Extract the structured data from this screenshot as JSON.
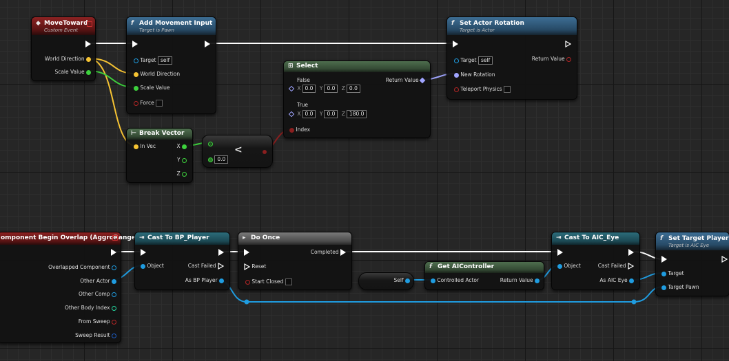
{
  "colors": {
    "exec": "#ffffff",
    "vector": "#f5c333",
    "float": "#3dd13d",
    "object": "#1f9ce0",
    "rotator": "#a0a5ff",
    "bool": "#b42626",
    "int": "#26d9a1",
    "struct": "#1d5cc4"
  },
  "nodes": {
    "move_toward": {
      "title": "MoveToward",
      "subtitle": "Custom Event",
      "pins": {
        "world_direction": "World Direction",
        "scale_value": "Scale Value"
      }
    },
    "add_movement": {
      "title": "Add Movement Input",
      "subtitle": "Target is Pawn",
      "pins": {
        "target": "Target",
        "target_value": "self",
        "world_direction": "World Direction",
        "scale_value": "Scale Value",
        "force": "Force"
      }
    },
    "set_rotation": {
      "title": "Set Actor Rotation",
      "subtitle": "Target is Actor",
      "pins": {
        "target": "Target",
        "target_value": "self",
        "return_value": "Return Value",
        "new_rotation": "New Rotation",
        "teleport": "Teleport Physics"
      }
    },
    "select": {
      "title": "Select",
      "pins": {
        "false": "False",
        "true": "True",
        "return_value": "Return Value",
        "index": "Index"
      },
      "false_vals": {
        "x": "0.0",
        "y": "0.0",
        "z": "0.0"
      },
      "true_vals": {
        "x": "0.0",
        "y": "0.0",
        "z": "180.0"
      },
      "axis": {
        "x": "X",
        "y": "Y",
        "z": "Z"
      }
    },
    "break_vector": {
      "title": "Break Vector",
      "pins": {
        "in_vec": "In Vec",
        "x": "X",
        "y": "Y",
        "z": "Z"
      }
    },
    "compare": {
      "op": "<",
      "value": "0.0"
    },
    "overlap": {
      "title": "omponent Begin Overlap (AggroRange)",
      "pins": {
        "overlapped": "Overlapped Component",
        "other_actor": "Other Actor",
        "other_comp": "Other Comp",
        "body_index": "Other Body Index",
        "from_sweep": "From Sweep",
        "sweep_result": "Sweep Result"
      }
    },
    "cast_player": {
      "title": "Cast To BP_Player",
      "pins": {
        "object": "Object",
        "cast_failed": "Cast Failed",
        "as_player": "As BP Player"
      }
    },
    "do_once": {
      "title": "Do Once",
      "pins": {
        "completed": "Completed",
        "reset": "Reset",
        "start_closed": "Start Closed"
      }
    },
    "self_node": {
      "label": "Self"
    },
    "get_controller": {
      "title": "Get AIController",
      "pins": {
        "controlled_actor": "Controlled Actor",
        "return_value": "Return Value"
      }
    },
    "cast_eye": {
      "title": "Cast To AIC_Eye",
      "pins": {
        "object": "Object",
        "cast_failed": "Cast Failed",
        "as_eye": "As AIC Eye"
      }
    },
    "set_target": {
      "title": "Set Target Player",
      "subtitle": "Target is AIC Eye",
      "pins": {
        "target": "Target",
        "target_pawn": "Target Pawn"
      }
    }
  }
}
